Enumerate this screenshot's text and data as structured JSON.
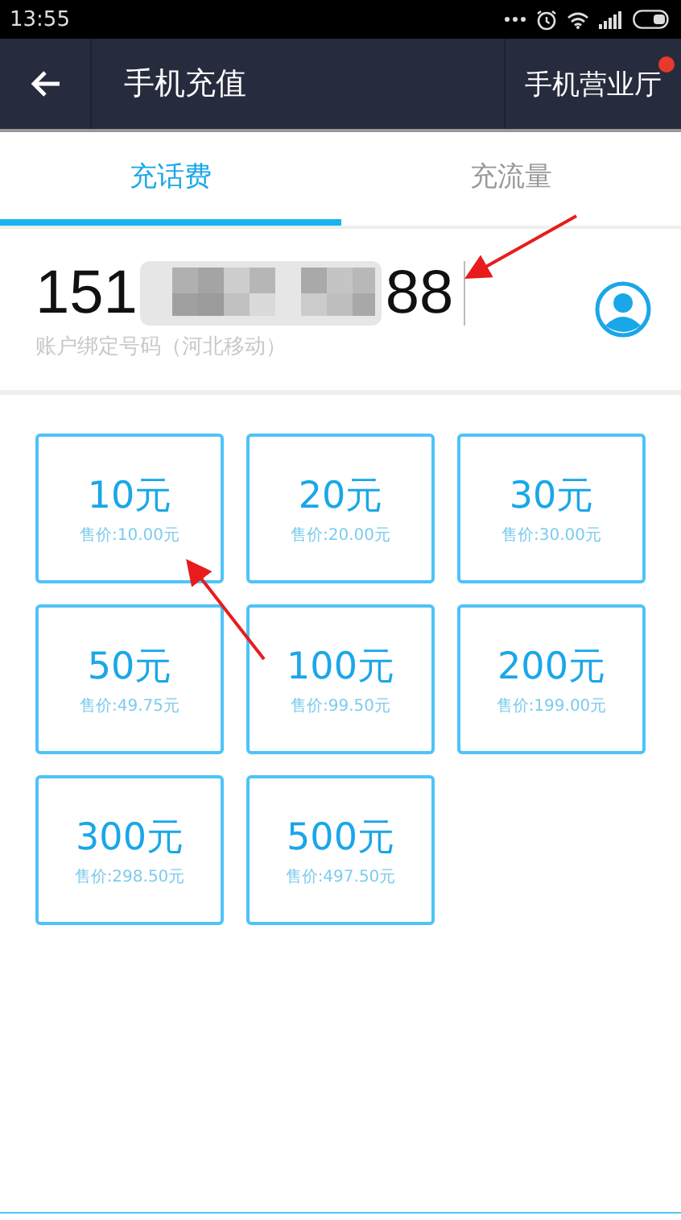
{
  "status_bar": {
    "time": "13:55"
  },
  "header": {
    "title": "手机充值",
    "action": "手机营业厅",
    "action_badge": true
  },
  "tabs": [
    {
      "label": "充话费",
      "selected": true
    },
    {
      "label": "充流量",
      "selected": false
    }
  ],
  "phone": {
    "prefix": "151",
    "suffix": "88",
    "hint": "账户绑定号码（河北移动）"
  },
  "options": [
    {
      "amount": "10元",
      "price": "售价:10.00元"
    },
    {
      "amount": "20元",
      "price": "售价:20.00元"
    },
    {
      "amount": "30元",
      "price": "售价:30.00元"
    },
    {
      "amount": "50元",
      "price": "售价:49.75元"
    },
    {
      "amount": "100元",
      "price": "售价:99.50元"
    },
    {
      "amount": "200元",
      "price": "售价:199.00元"
    },
    {
      "amount": "300元",
      "price": "售价:298.50元"
    },
    {
      "amount": "500元",
      "price": "售价:497.50元"
    }
  ]
}
